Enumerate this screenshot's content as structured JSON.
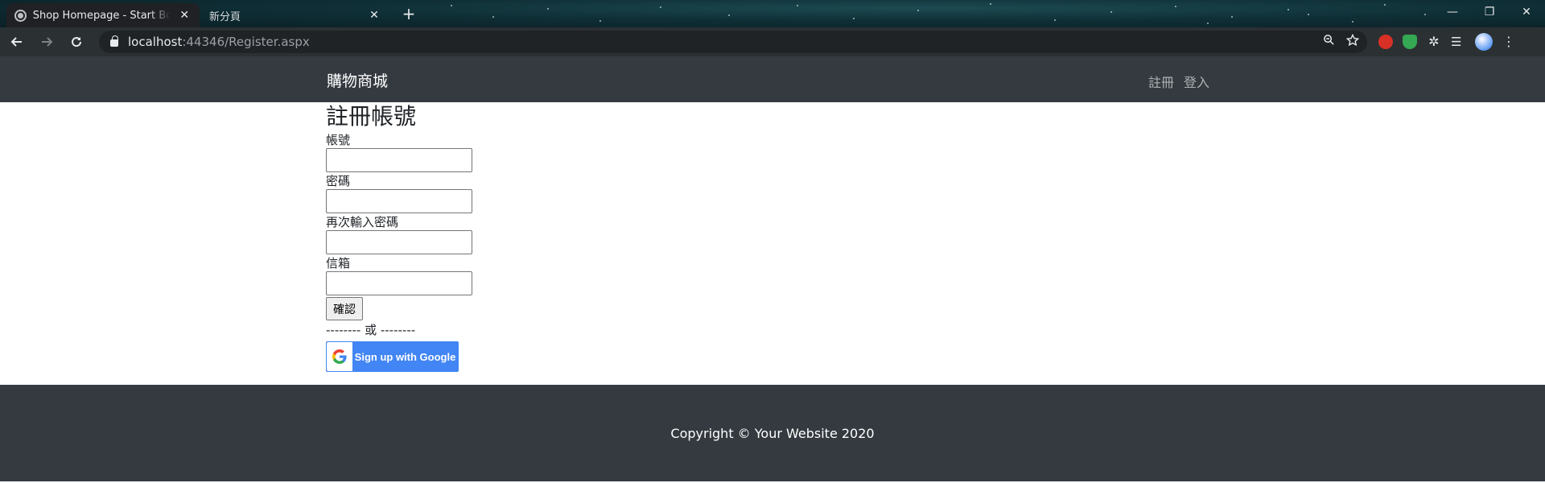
{
  "browser": {
    "tabs": [
      {
        "title": "Shop Homepage - Start Bootstrap",
        "active": true
      },
      {
        "title": "新分頁",
        "active": false
      }
    ],
    "new_tab_symbol": "+",
    "close_symbol": "✕",
    "window_controls": {
      "minimize": "—",
      "restore": "❐",
      "close": "✕"
    },
    "address": {
      "host": "localhost",
      "rest": ":44346/Register.aspx"
    }
  },
  "navbar": {
    "brand": "購物商城",
    "links": [
      "註冊",
      "登入"
    ]
  },
  "form": {
    "title": "註冊帳號",
    "fields": [
      {
        "label": "帳號",
        "value": ""
      },
      {
        "label": "密碼",
        "value": ""
      },
      {
        "label": "再次輸入密碼",
        "value": ""
      },
      {
        "label": "信箱",
        "value": ""
      }
    ],
    "submit_label": "確認",
    "divider": "-------- 或 --------",
    "google_label": "Sign up with Google"
  },
  "footer": {
    "copyright": "Copyright © Your Website 2020"
  },
  "colors": {
    "navbar_bg": "#343a40",
    "google_blue": "#4285f4",
    "chrome_dark": "#202124"
  }
}
